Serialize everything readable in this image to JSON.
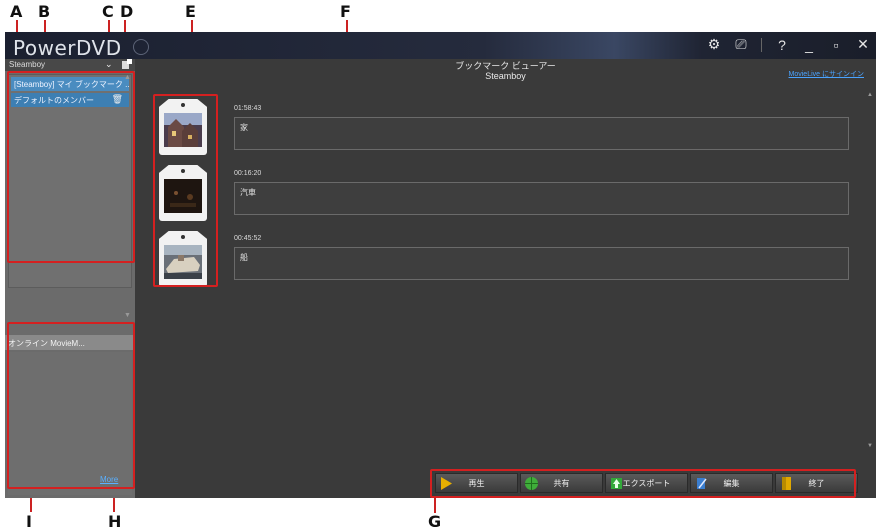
{
  "callouts": {
    "A": "A",
    "B": "B",
    "C": "C",
    "D": "D",
    "E": "E",
    "F": "F",
    "G": "G",
    "H": "H",
    "I": "I"
  },
  "app": {
    "brand": "PowerDVD"
  },
  "window_controls": {
    "settings": "⚙",
    "tv": "⎚",
    "help": "?",
    "minimize": "_",
    "restore": "▫",
    "close": "✕"
  },
  "sidebar": {
    "user": "Steamboy",
    "dropdown": "⌄",
    "bookmarks": [
      {
        "label": "[Steamboy] マイ ブックマーク ..."
      },
      {
        "label": "デフォルトのメンバー"
      }
    ],
    "online_header": "オンライン MovieM...",
    "more_link": "More"
  },
  "main": {
    "title": "ブックマーク ビューアー",
    "subtitle": "Steamboy",
    "signin": "MovieLive にサインイン",
    "entries": [
      {
        "time": "01:58:43",
        "text": "家"
      },
      {
        "time": "00:16:20",
        "text": "汽車"
      },
      {
        "time": "00:45:52",
        "text": "船"
      }
    ]
  },
  "buttons": [
    {
      "label": "再生",
      "icon": "play-icon",
      "color": "#e8b000"
    },
    {
      "label": "共有",
      "icon": "globe-icon",
      "color": "#3fae3a"
    },
    {
      "label": "エクスポート",
      "icon": "export-icon",
      "color": "#33a83a"
    },
    {
      "label": "編集",
      "icon": "edit-icon",
      "color": "#3a7ed0"
    },
    {
      "label": "終了",
      "icon": "exit-icon",
      "color": "#e0a800"
    }
  ]
}
